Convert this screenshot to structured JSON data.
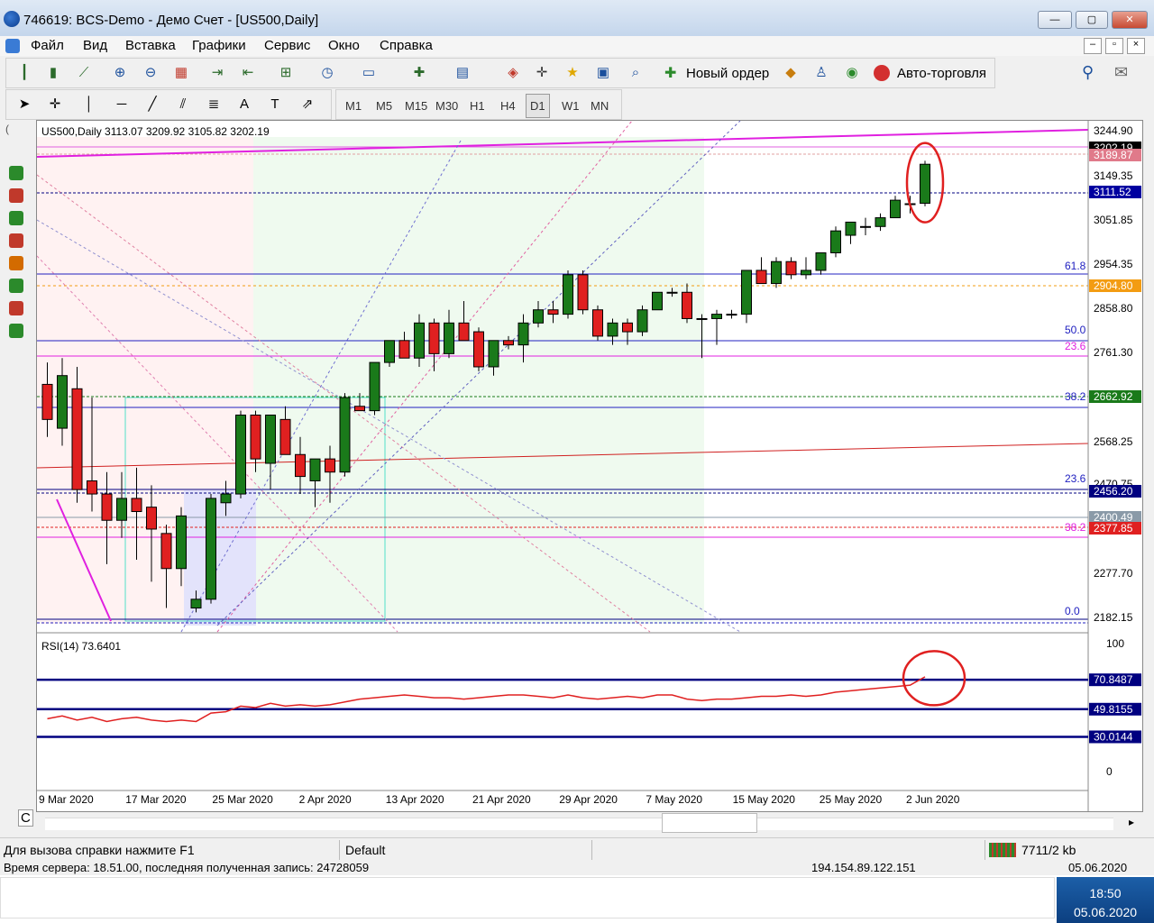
{
  "window": {
    "title": "746619: BCS-Demo - Демо Счет - [US500,Daily]",
    "min": "—",
    "max": "▢",
    "close": "✕"
  },
  "menu": [
    "Файл",
    "Вид",
    "Вставка",
    "Графики",
    "Сервис",
    "Окно",
    "Справка"
  ],
  "toolbar": {
    "new_order": "Новый ордер",
    "auto_trading": "Авто-торговля"
  },
  "timeframes": [
    "M1",
    "M5",
    "M15",
    "M30",
    "H1",
    "H4",
    "D1",
    "W1",
    "MN"
  ],
  "chart": {
    "header": "US500,Daily  3113.07 3209.92 3105.82 3202.19",
    "rsi_label": "RSI(14) 73.6401",
    "left_tab": "C"
  },
  "price_axis": [
    "3244.90",
    "3149.35",
    "3051.85",
    "2954.35",
    "2858.80",
    "2761.30",
    "2568.25",
    "2470.75",
    "2277.70",
    "2182.15"
  ],
  "price_tags": [
    {
      "text": "3202.19",
      "bg": "#000000",
      "color": "#ffffff"
    },
    {
      "text": "3189.87",
      "bg": "#e07a8a",
      "color": "#ffffff"
    },
    {
      "text": "3111.52",
      "bg": "#0000a0",
      "color": "#ffffff"
    },
    {
      "text": "2904.80",
      "bg": "#f39c12",
      "color": "#ffffff"
    },
    {
      "text": "2662.92",
      "bg": "#1a7a1a",
      "color": "#ffffff"
    },
    {
      "text": "2456.20",
      "bg": "#000080",
      "color": "#ffffff"
    },
    {
      "text": "2400.49",
      "bg": "#8a9aa8",
      "color": "#ffffff"
    },
    {
      "text": "2377.85",
      "bg": "#e02020",
      "color": "#ffffff"
    }
  ],
  "fib_labels": [
    "61.8",
    "50.0",
    "23.6",
    "38.2",
    "23.6",
    "38.2",
    "0.0"
  ],
  "rsi_axis": [
    "100",
    "70.8487",
    "49.8155",
    "30.0144",
    "0"
  ],
  "date_axis": [
    "9 Mar 2020",
    "17 Mar 2020",
    "25 Mar 2020",
    "2 Apr 2020",
    "13 Apr 2020",
    "21 Apr 2020",
    "29 Apr 2020",
    "7 May 2020",
    "15 May 2020",
    "25 May 2020",
    "2 Jun 2020"
  ],
  "status": {
    "help": "Для вызова справки нажмите F1",
    "profile": "Default",
    "traffic": "7711/2 kb"
  },
  "partial_row": {
    "left": "Время сервера: 18.51.00, последняя полученная запись: 24728059",
    "mid": "194.154.89.122.151",
    "right": "05.06.2020"
  },
  "clock": {
    "time": "18:50",
    "date": "05.06.2020"
  },
  "chart_data": {
    "type": "candlestick",
    "symbol": "US500",
    "timeframe": "Daily",
    "candles": [
      [
        2700,
        2750,
        2580,
        2620
      ],
      [
        2600,
        2760,
        2560,
        2720
      ],
      [
        2690,
        2740,
        2430,
        2460
      ],
      [
        2480,
        2670,
        2410,
        2450
      ],
      [
        2450,
        2500,
        2290,
        2390
      ],
      [
        2390,
        2500,
        2350,
        2440
      ],
      [
        2440,
        2510,
        2300,
        2410
      ],
      [
        2420,
        2470,
        2250,
        2370
      ],
      [
        2360,
        2380,
        2190,
        2280
      ],
      [
        2280,
        2420,
        2240,
        2400
      ],
      [
        2190,
        2230,
        2180,
        2210
      ],
      [
        2210,
        2450,
        2200,
        2440
      ],
      [
        2430,
        2480,
        2400,
        2450
      ],
      [
        2450,
        2640,
        2440,
        2630
      ],
      [
        2630,
        2640,
        2500,
        2530
      ],
      [
        2520,
        2630,
        2460,
        2630
      ],
      [
        2620,
        2650,
        2540,
        2540
      ],
      [
        2540,
        2580,
        2450,
        2490
      ],
      [
        2480,
        2520,
        2420,
        2530
      ],
      [
        2530,
        2560,
        2430,
        2500
      ],
      [
        2500,
        2680,
        2490,
        2670
      ],
      [
        2650,
        2680,
        2640,
        2640
      ],
      [
        2640,
        2750,
        2630,
        2750
      ],
      [
        2750,
        2800,
        2740,
        2800
      ],
      [
        2800,
        2820,
        2760,
        2760
      ],
      [
        2760,
        2860,
        2740,
        2840
      ],
      [
        2840,
        2850,
        2730,
        2770
      ],
      [
        2770,
        2870,
        2760,
        2840
      ],
      [
        2840,
        2890,
        2800,
        2800
      ],
      [
        2820,
        2830,
        2730,
        2740
      ],
      [
        2740,
        2800,
        2720,
        2800
      ],
      [
        2800,
        2810,
        2780,
        2790
      ],
      [
        2790,
        2860,
        2750,
        2840
      ],
      [
        2840,
        2890,
        2830,
        2870
      ],
      [
        2870,
        2890,
        2840,
        2860
      ],
      [
        2860,
        2960,
        2850,
        2950
      ],
      [
        2950,
        2960,
        2860,
        2870
      ],
      [
        2870,
        2880,
        2800,
        2810
      ],
      [
        2810,
        2850,
        2790,
        2840
      ],
      [
        2840,
        2850,
        2790,
        2820
      ],
      [
        2820,
        2880,
        2810,
        2870
      ],
      [
        2870,
        2910,
        2870,
        2910
      ],
      [
        2910,
        2920,
        2900,
        2910
      ],
      [
        2910,
        2930,
        2840,
        2850
      ],
      [
        2850,
        2860,
        2760,
        2850
      ],
      [
        2850,
        2870,
        2790,
        2860
      ],
      [
        2860,
        2870,
        2850,
        2860
      ],
      [
        2860,
        2960,
        2840,
        2960
      ],
      [
        2960,
        2990,
        2940,
        2930
      ],
      [
        2930,
        2990,
        2920,
        2980
      ],
      [
        2980,
        2990,
        2940,
        2950
      ],
      [
        2950,
        2990,
        2940,
        2960
      ],
      [
        2960,
        3000,
        2950,
        3000
      ],
      [
        3000,
        3060,
        2990,
        3050
      ],
      [
        3040,
        3070,
        3020,
        3070
      ],
      [
        3060,
        3080,
        3040,
        3060
      ],
      [
        3060,
        3090,
        3050,
        3080
      ],
      [
        3080,
        3130,
        3080,
        3120
      ],
      [
        3110,
        3130,
        3090,
        3112
      ],
      [
        3113,
        3210,
        3106,
        3202
      ]
    ],
    "rsi": [
      43,
      45,
      42,
      44,
      41,
      43,
      44,
      42,
      41,
      42,
      41,
      47,
      48,
      52,
      51,
      54,
      52,
      53,
      52,
      53,
      55,
      57,
      58,
      59,
      60,
      59,
      58,
      58,
      57,
      58,
      59,
      60,
      60,
      59,
      58,
      60,
      58,
      57,
      58,
      59,
      58,
      60,
      60,
      57,
      56,
      57,
      57,
      58,
      59,
      59,
      60,
      59,
      60,
      62,
      63,
      64,
      65,
      66,
      67,
      73
    ],
    "rsi_levels": [
      70.8487,
      49.8155,
      30.0144
    ],
    "ylim": [
      2150,
      3260
    ]
  }
}
